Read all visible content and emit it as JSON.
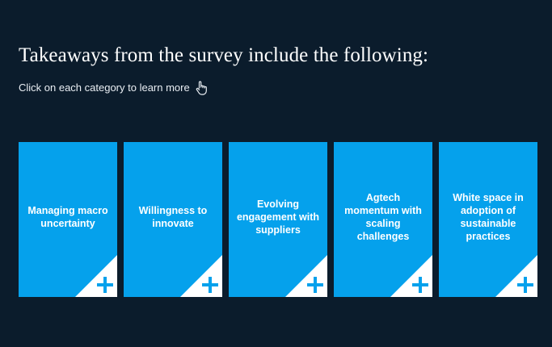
{
  "header": {
    "title": "Takeaways from the survey include the following:",
    "subtitle": "Click on each category to learn more",
    "subtitle_icon": "pointer-hand-icon"
  },
  "colors": {
    "background": "#0b1c2c",
    "card": "#05a1ec",
    "corner": "#ffffff",
    "text": "#ffffff"
  },
  "cards": [
    {
      "label": "Managing macro uncertainty",
      "icon": "plus-icon"
    },
    {
      "label": "Willingness to innovate",
      "icon": "plus-icon"
    },
    {
      "label": "Evolving engagement with suppliers",
      "icon": "plus-icon"
    },
    {
      "label": "Agtech momentum with scaling challenges",
      "icon": "plus-icon"
    },
    {
      "label": "White space in adoption of sustainable practices",
      "icon": "plus-icon"
    }
  ]
}
